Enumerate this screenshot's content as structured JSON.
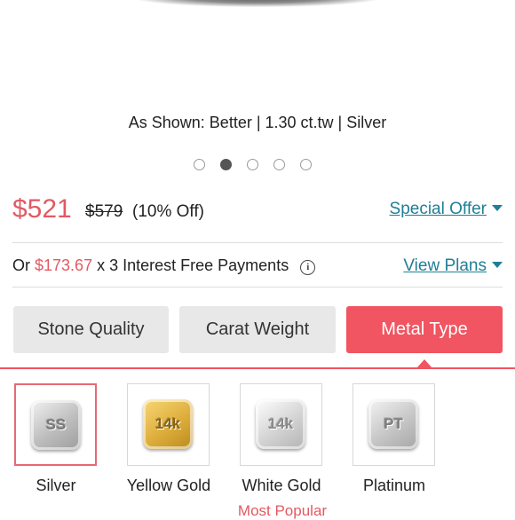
{
  "caption": "As Shown: Better | 1.30 ct.tw | Silver",
  "carousel": {
    "count": 5,
    "active_index": 2
  },
  "price": {
    "current": "$521",
    "original": "$579",
    "discount": "(10% Off)"
  },
  "special_offer": {
    "label": "Special Offer"
  },
  "payment": {
    "prefix": "Or",
    "amount": "$173.67",
    "suffix": "x 3 Interest Free Payments",
    "info_icon": "i"
  },
  "view_plans": {
    "label": "View Plans"
  },
  "tabs": [
    {
      "label": "Stone Quality",
      "active": false
    },
    {
      "label": "Carat Weight",
      "active": false
    },
    {
      "label": "Metal Type",
      "active": true
    }
  ],
  "metals": [
    {
      "code": "SS",
      "label": "Silver",
      "selected": true
    },
    {
      "code": "14k",
      "label": "Yellow Gold",
      "selected": false
    },
    {
      "code": "14k",
      "label": "White Gold",
      "selected": false
    },
    {
      "code": "PT",
      "label": "Platinum",
      "selected": false
    }
  ],
  "most_popular": "Most Popular",
  "colors": {
    "accent": "#f05561",
    "price_red": "#e15a62",
    "link": "#1f7f95"
  }
}
